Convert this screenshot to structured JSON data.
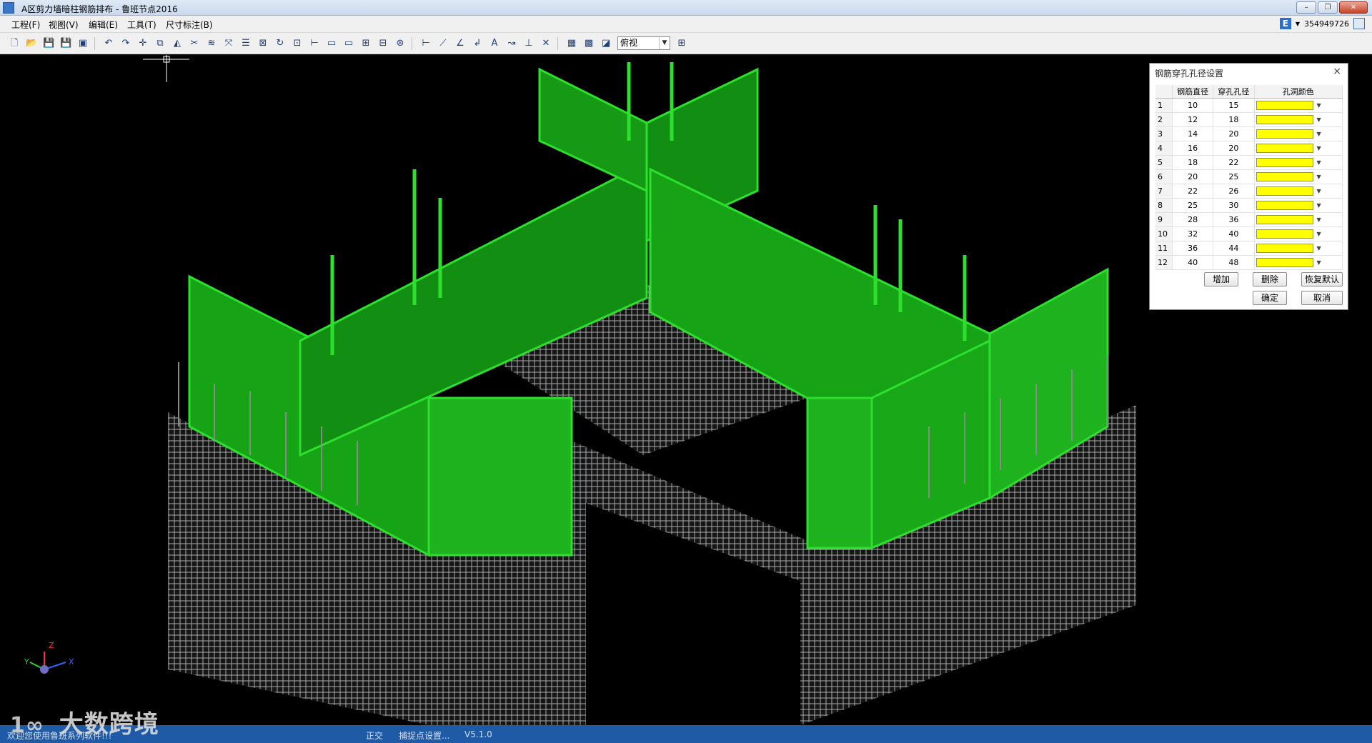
{
  "window": {
    "title": "A区剪力墙暗柱钢筋排布 - 鲁班节点2016"
  },
  "menu": [
    "工程(F)",
    "视图(V)",
    "编辑(E)",
    "工具(T)",
    "尺寸标注(B)"
  ],
  "account": {
    "id": "354949726"
  },
  "toolbar": {
    "view_select": "俯视"
  },
  "axes": {
    "x": "X",
    "y": "Y",
    "z": "Z"
  },
  "dialog": {
    "title": "钢筋穿孔孔径设置",
    "columns": [
      "钢筋直径",
      "穿孔孔径",
      "孔洞颜色"
    ],
    "rows": [
      {
        "n": "1",
        "d": "10",
        "h": "15"
      },
      {
        "n": "2",
        "d": "12",
        "h": "18"
      },
      {
        "n": "3",
        "d": "14",
        "h": "20"
      },
      {
        "n": "4",
        "d": "16",
        "h": "20"
      },
      {
        "n": "5",
        "d": "18",
        "h": "22"
      },
      {
        "n": "6",
        "d": "20",
        "h": "25"
      },
      {
        "n": "7",
        "d": "22",
        "h": "26"
      },
      {
        "n": "8",
        "d": "25",
        "h": "30"
      },
      {
        "n": "9",
        "d": "28",
        "h": "36"
      },
      {
        "n": "10",
        "d": "32",
        "h": "40"
      },
      {
        "n": "11",
        "d": "36",
        "h": "44"
      },
      {
        "n": "12",
        "d": "40",
        "h": "48"
      }
    ],
    "hole_color": "#ffff00",
    "buttons": {
      "add": "增加",
      "delete": "删除",
      "restore": "恢复默认",
      "ok": "确定",
      "cancel": "取消"
    }
  },
  "status": {
    "message": "欢迎您使用鲁班系列软件!!!",
    "mode": "正交",
    "snap": "捕捉点设置...",
    "version": "V5.1.0"
  },
  "watermark": {
    "text": "大数跨境"
  },
  "colors": {
    "formwork": "#22b322",
    "rebar": "#b8b8b8",
    "status_bg": "#1f5aa6"
  }
}
